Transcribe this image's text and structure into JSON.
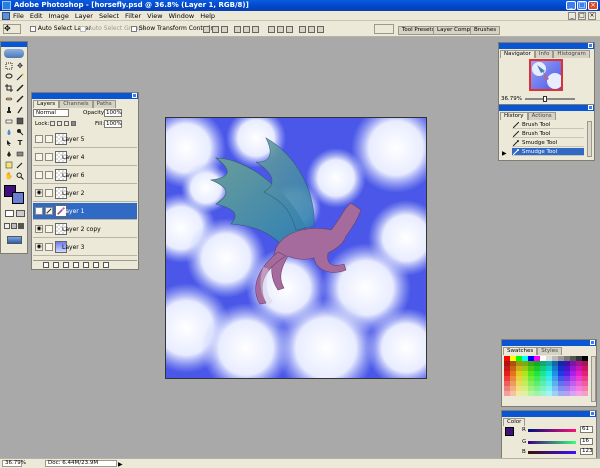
{
  "window": {
    "title": "Adobe Photoshop - [horsefly.psd @ 36.8% (Layer 1, RGB/8)]",
    "controls": [
      "_",
      "□",
      "×"
    ]
  },
  "menu": [
    "File",
    "Edit",
    "Image",
    "Layer",
    "Select",
    "Filter",
    "View",
    "Window",
    "Help"
  ],
  "mdi_controls": [
    "_",
    "□",
    "×"
  ],
  "options": {
    "auto_select_layer": "Auto Select Layer",
    "auto_select_groups": "Auto Select Groups",
    "show_transform_controls": "Show Transform Controls"
  },
  "palette_well": [
    "Tool Presets",
    "Layer Comps",
    "Brushes"
  ],
  "layers_panel": {
    "tabs": [
      "Layers",
      "Channels",
      "Paths"
    ],
    "blend_mode": "Normal",
    "opacity_label": "Opacity:",
    "opacity": "100%",
    "lock_label": "Lock:",
    "fill_label": "Fill:",
    "fill": "100%",
    "layers": [
      {
        "name": "Layer 5",
        "visible": false,
        "selected": false
      },
      {
        "name": "Layer 4",
        "visible": false,
        "selected": false
      },
      {
        "name": "Layer 6",
        "visible": false,
        "selected": false
      },
      {
        "name": "Layer 2",
        "visible": true,
        "selected": false
      },
      {
        "name": "Layer 1",
        "visible": true,
        "selected": true
      },
      {
        "name": "Layer 2 copy",
        "visible": true,
        "selected": false
      },
      {
        "name": "Layer 3",
        "visible": true,
        "selected": false
      }
    ]
  },
  "navigator": {
    "tabs": [
      "Navigator",
      "Info",
      "Histogram"
    ],
    "zoom": "36.79%"
  },
  "history": {
    "tabs": [
      "History",
      "Actions"
    ],
    "items": [
      {
        "label": "Brush Tool",
        "selected": false
      },
      {
        "label": "Brush Tool",
        "selected": false
      },
      {
        "label": "Smudge Tool",
        "selected": false
      },
      {
        "label": "Smudge Tool",
        "selected": true
      }
    ]
  },
  "swatches": {
    "tabs": [
      "Swatches",
      "Styles"
    ]
  },
  "color": {
    "tab": "Color",
    "r_label": "R",
    "g_label": "G",
    "b_label": "B",
    "r": "61",
    "g": "16",
    "b": "123",
    "foreground": "#3d107b"
  },
  "status": {
    "zoom": "36.79%",
    "doc": "Doc: 6.44M/23.9M"
  },
  "colors": {
    "title_blue": "#0a55d4",
    "selection_blue": "#316ac5",
    "chrome": "#ece9d8",
    "workspace": "#a9a9a9",
    "sky": "#4a57e8"
  }
}
